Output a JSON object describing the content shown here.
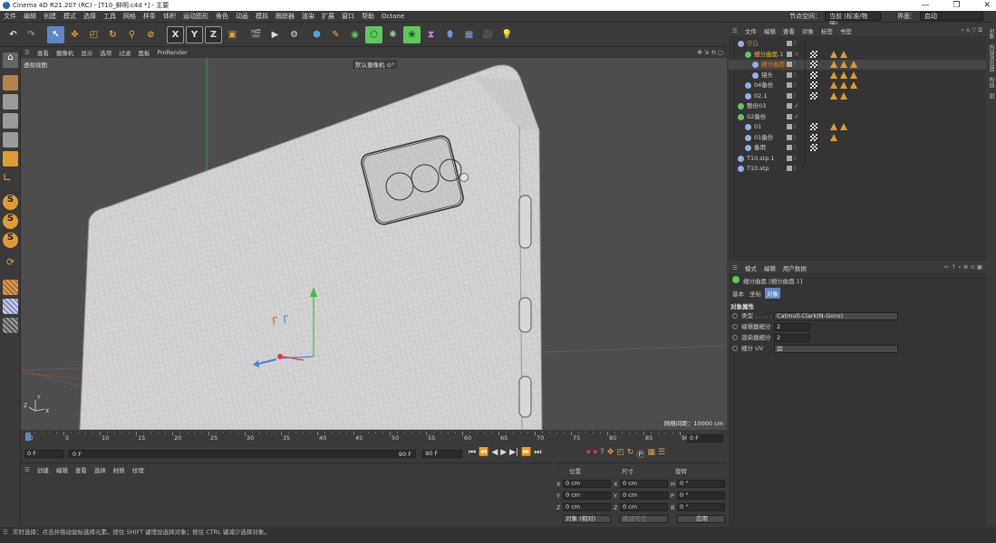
{
  "window": {
    "title": "Cinema 4D R21.207 (RC) - [T10_鲜明.c4d *] - 主要",
    "controls": [
      "—",
      "❐",
      "✕"
    ]
  },
  "menubar": {
    "items": [
      "文件",
      "编辑",
      "创建",
      "模式",
      "选择",
      "工具",
      "网格",
      "样条",
      "体积",
      "运动图形",
      "角色",
      "动画",
      "模拟",
      "跟踪器",
      "渲染",
      "扩展",
      "窗口",
      "帮助",
      "Octane"
    ],
    "node_space_label": "节点空间：",
    "node_space_value": "当前 (标准/物理)",
    "interface_label": "界面：",
    "interface_value": "启动"
  },
  "viewport": {
    "menu": [
      "查看",
      "摄像机",
      "显示",
      "选项",
      "过滤",
      "面板",
      "ProRender"
    ],
    "name": "透视视图",
    "camera": "默认摄像机 ⊙°",
    "grid_spacing": "网格间距：10000 cm"
  },
  "timeline": {
    "ticks": [
      "0",
      "5",
      "10",
      "15",
      "20",
      "25",
      "30",
      "35",
      "40",
      "45",
      "50",
      "55",
      "60",
      "65",
      "70",
      "75",
      "80",
      "85",
      "90"
    ],
    "current_frame": "0 F",
    "start": "0 F",
    "range_start": "0 F",
    "range_end": "90 F",
    "end": "90 F",
    "display_frame": "0 F"
  },
  "material_panel": {
    "menu": [
      "创建",
      "编辑",
      "查看",
      "选择",
      "材质",
      "纹理"
    ]
  },
  "coords": {
    "headers": [
      "位置",
      "尺寸",
      "旋转"
    ],
    "rows": [
      {
        "axis": "X",
        "pos": "0 cm",
        "size_axis": "X",
        "size": "0 cm",
        "rot_axis": "H",
        "rot": "0 °"
      },
      {
        "axis": "Y",
        "pos": "0 cm",
        "size_axis": "Y",
        "size": "0 cm",
        "rot_axis": "P",
        "rot": "0 °"
      },
      {
        "axis": "Z",
        "pos": "0 cm",
        "size_axis": "Z",
        "size": "0 cm",
        "rot_axis": "B",
        "rot": "0 °"
      }
    ],
    "mode": "对象 (相对)",
    "size_mode": "绝对尺寸",
    "apply": "应用"
  },
  "object_manager": {
    "menu": [
      "文件",
      "编辑",
      "查看",
      "对象",
      "标签",
      "书签"
    ],
    "objects": [
      {
        "name": "空白",
        "color": "#e0831a",
        "indent": 0
      },
      {
        "name": "细分曲面.1",
        "color": "#e0c040",
        "indent": 1
      },
      {
        "name": "细分曲面",
        "color": "#e0831a",
        "indent": 2
      },
      {
        "name": "镜头",
        "color": "#cfcfcf",
        "indent": 2
      },
      {
        "name": "04备份",
        "color": "#cfcfcf",
        "indent": 1
      },
      {
        "name": "02.1",
        "color": "#cfcfcf",
        "indent": 1
      },
      {
        "name": "整份03",
        "color": "#cfcfcf",
        "indent": 0
      },
      {
        "name": "02备份",
        "color": "#cfcfcf",
        "indent": 0
      },
      {
        "name": "01",
        "color": "#cfcfcf",
        "indent": 1
      },
      {
        "name": "01备份",
        "color": "#cfcfcf",
        "indent": 1
      },
      {
        "name": "备用",
        "color": "#cfcfcf",
        "indent": 1
      },
      {
        "name": "T10.stp.1",
        "color": "#cfcfcf",
        "indent": 0
      },
      {
        "name": "T10.stp",
        "color": "#cfcfcf",
        "indent": 0
      }
    ]
  },
  "attribute_manager": {
    "menu": [
      "模式",
      "编辑",
      "用户数据"
    ],
    "object_title": "细分曲面 [细分曲面.1]",
    "tabs": [
      "基本",
      "坐标",
      "对象"
    ],
    "section": "对象属性",
    "props": [
      {
        "label": "类型 . . . . . . .",
        "value": "Catmull-Clark(N-Gons)"
      },
      {
        "label": "编辑器细分",
        "value": "2"
      },
      {
        "label": "渲染器细分",
        "value": "2"
      },
      {
        "label": "细分 UV",
        "value": "边"
      }
    ]
  },
  "status": {
    "text": "实时选择：点击并拖动鼠标选择元素。按住 SHIFT 键增加选择对象；按住 CTRL 键减少选择对象。"
  },
  "right_strip": {
    "tabs": [
      "对象",
      "内容浏览器",
      "构造",
      "层"
    ]
  }
}
